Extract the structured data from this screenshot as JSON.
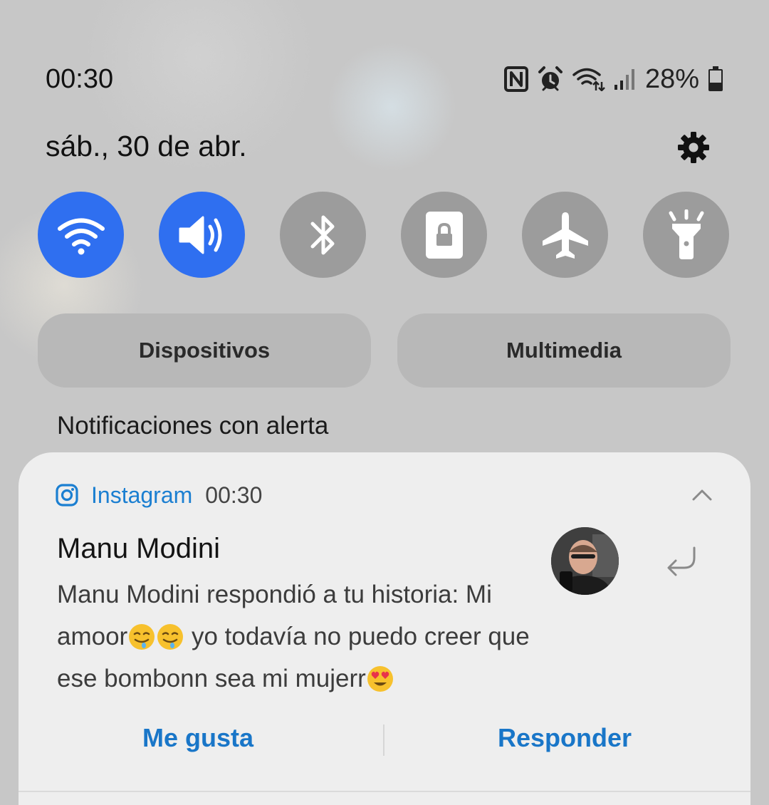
{
  "status_bar": {
    "time": "00:30",
    "battery": "28%",
    "icons": [
      "nfc-icon",
      "alarm-icon",
      "wifi-data-icon",
      "cell-signal-icon",
      "battery-icon"
    ]
  },
  "header": {
    "date": "sáb., 30 de abr.",
    "settings_icon": "gear-icon"
  },
  "quick_settings": [
    {
      "name": "wifi",
      "icon": "wifi-icon",
      "active": true
    },
    {
      "name": "sound",
      "icon": "speaker-icon",
      "active": true
    },
    {
      "name": "bluetooth",
      "icon": "bluetooth-icon",
      "active": false
    },
    {
      "name": "rotation-lock",
      "icon": "lock-icon",
      "active": false
    },
    {
      "name": "airplane-mode",
      "icon": "airplane-icon",
      "active": false
    },
    {
      "name": "flashlight",
      "icon": "flashlight-icon",
      "active": false
    }
  ],
  "buttons": {
    "devices": "Dispositivos",
    "media": "Multimedia"
  },
  "notifications_heading": "Notificaciones con alerta",
  "notification": {
    "app": "Instagram",
    "time": "00:30",
    "sender": "Manu Modini",
    "message_part1": "Manu Modini respondió a tu historia: Mi amoor",
    "message_part2": " yo todavía no puedo creer que ese bombonn sea mi mujerr",
    "actions": {
      "like": "Me gusta",
      "reply": "Responder"
    }
  },
  "colors": {
    "accent": "#2f6ff0",
    "link": "#1976c8",
    "background": "#c7c7c7",
    "card": "#eeeeee"
  }
}
